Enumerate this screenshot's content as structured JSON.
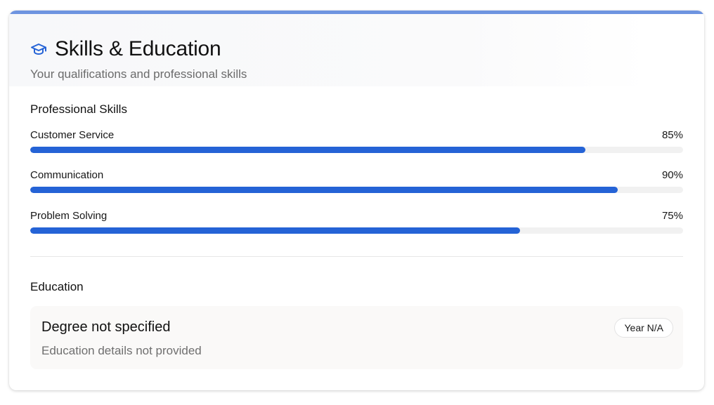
{
  "header": {
    "icon": "graduation-cap-icon",
    "title": "Skills & Education",
    "subtitle": "Your qualifications and professional skills"
  },
  "skills": {
    "section_title": "Professional Skills",
    "items": [
      {
        "name": "Customer Service",
        "percent_label": "85%",
        "level": 0.85
      },
      {
        "name": "Communication",
        "percent_label": "90%",
        "level": 0.9
      },
      {
        "name": "Problem Solving",
        "percent_label": "75%",
        "level": 0.75
      }
    ]
  },
  "education": {
    "section_title": "Education",
    "degree": "Degree not specified",
    "details": "Education details not provided",
    "year": "Year N/A"
  },
  "colors": {
    "accent": "#2563d6",
    "top_bar": "#6e94e0",
    "track": "#f1f1f1"
  }
}
